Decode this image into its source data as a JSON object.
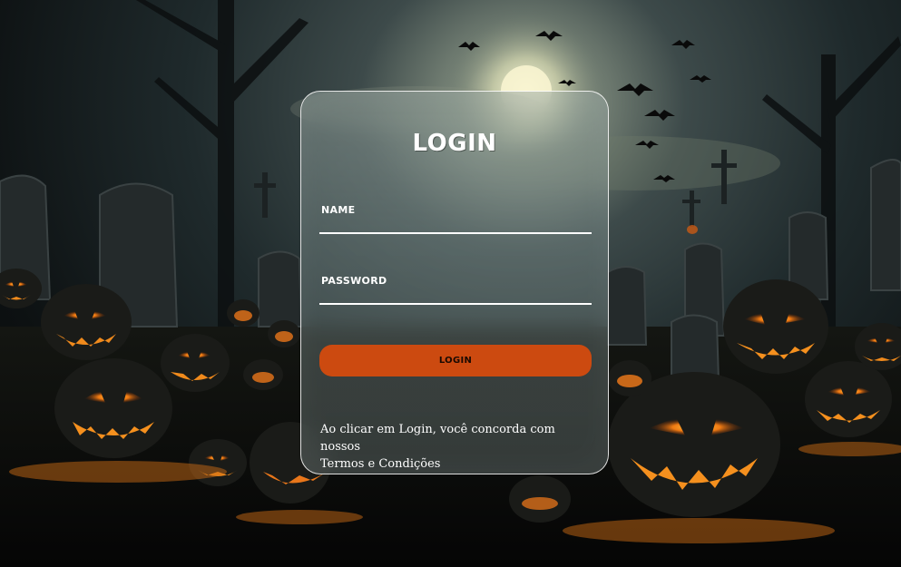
{
  "login": {
    "title": "LOGIN",
    "name_label": "NAME",
    "name_value": "",
    "password_label": "PASSWORD",
    "password_value": "",
    "submit_label": "LOGIN",
    "terms_text": "Ao clicar em Login, você concorda com nossos",
    "terms_link": "Termos e Condições"
  },
  "colors": {
    "accent": "#cc4a10",
    "text": "#ffffff",
    "card_border": "#ffffff"
  },
  "background": {
    "description_icon": "halloween-graveyard-background"
  }
}
